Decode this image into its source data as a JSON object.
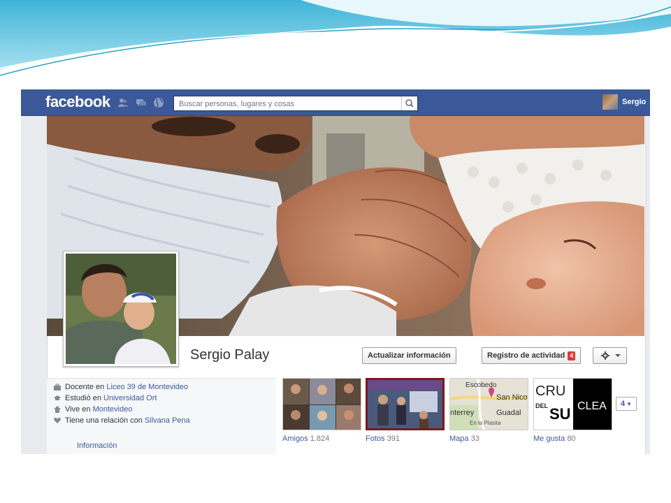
{
  "topbar": {
    "logo": "facebook",
    "search_placeholder": "Buscar personas, lugares y cosas",
    "user_name": "Sergio"
  },
  "profile": {
    "name": "Sergio Palay"
  },
  "actions": {
    "update_info": "Actualizar información",
    "activity_log": "Registro de actividad",
    "activity_badge": "4"
  },
  "about": {
    "items": [
      {
        "prefix": "Docente en ",
        "link": "Liceo 39 de Montevideo",
        "icon": "briefcase-icon"
      },
      {
        "prefix": "Estudió en ",
        "link": "Universidad Ort",
        "icon": "graduation-cap-icon"
      },
      {
        "prefix": "Vive en ",
        "link": "Montevideo",
        "icon": "house-icon"
      },
      {
        "prefix": "Tiene una relación con ",
        "link": "Silvana Pena",
        "icon": "heart-icon"
      }
    ],
    "more_link": "Información"
  },
  "apps": [
    {
      "label": "Amigos",
      "count": "1.824"
    },
    {
      "label": "Fotos",
      "count": "391"
    },
    {
      "label": "Mapa",
      "count": "33"
    },
    {
      "label": "Me gusta",
      "count": "80"
    }
  ],
  "map_tile": {
    "places": [
      "Escobedo",
      "San Nicol",
      "nterrey",
      "Guadal",
      "En la Plasita"
    ]
  },
  "like_tile": {
    "text1": "CRU",
    "text2": "DEL",
    "text3": "SU",
    "text4": "CLEA"
  },
  "more_apps": {
    "label": "4"
  },
  "colors": {
    "facebook_blue": "#3b5998",
    "badge_red": "#e0392b",
    "timeline_bg": "#e9ebee"
  }
}
